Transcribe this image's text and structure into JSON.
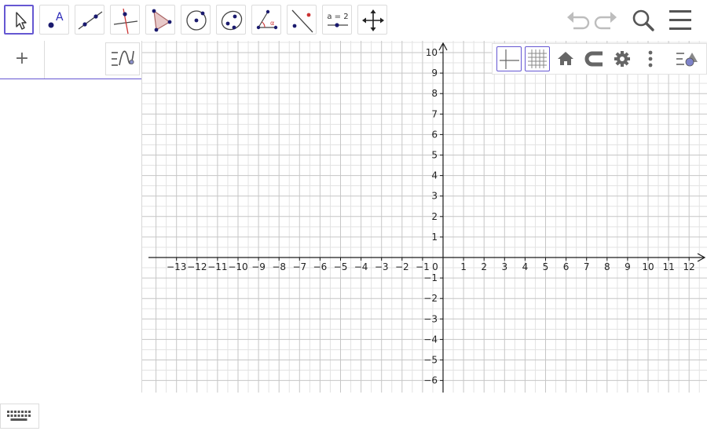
{
  "toolbar": {
    "tools": [
      {
        "name": "move-tool",
        "icon": "cursor-arrow-icon",
        "active": true
      },
      {
        "name": "point-tool",
        "icon": "point-label-icon",
        "label": "A"
      },
      {
        "name": "line-tool",
        "icon": "line-through-points-icon"
      },
      {
        "name": "perpendicular-line-tool",
        "icon": "perpendicular-line-icon"
      },
      {
        "name": "polygon-tool",
        "icon": "triangle-polygon-icon"
      },
      {
        "name": "circle-tool",
        "icon": "circle-center-icon"
      },
      {
        "name": "ellipse-tool",
        "icon": "ellipse-icon"
      },
      {
        "name": "angle-tool",
        "icon": "angle-icon",
        "label": "α"
      },
      {
        "name": "reflect-tool",
        "icon": "reflect-about-line-icon"
      },
      {
        "name": "slider-tool",
        "icon": "slider-icon",
        "label": "a = 2"
      },
      {
        "name": "move-graphics-view-tool",
        "icon": "move-arrows-icon"
      }
    ],
    "undo_icon": "undo-icon",
    "redo_icon": "redo-icon",
    "search_icon": "search-icon",
    "menu_icon": "hamburger-menu-icon"
  },
  "algebra": {
    "add_label": "+",
    "style_icon": "algebra-style-icon",
    "keyboard_icon": "keyboard-icon"
  },
  "graphics": {
    "x_range": [
      -14.3,
      12.7
    ],
    "y_range": [
      -6.4,
      10.6
    ],
    "x_ticks": [
      "−13",
      "−12",
      "−11",
      "−10",
      "−9",
      "−8",
      "−7",
      "−6",
      "−5",
      "−4",
      "−3",
      "−2",
      "−1",
      "0",
      "1",
      "2",
      "3",
      "4",
      "5",
      "6",
      "7",
      "8",
      "9",
      "10",
      "11",
      "12"
    ],
    "y_ticks": [
      "10",
      "9",
      "8",
      "7",
      "6",
      "5",
      "4",
      "3",
      "2",
      "1",
      "−1",
      "−2",
      "−3",
      "−4",
      "−5",
      "−6"
    ],
    "grid": true,
    "colors": {
      "grid_minor": "#e3e3e3",
      "grid_major": "#c6c6c6",
      "axis": "#1a1a1a",
      "accent": "#6557d2"
    }
  },
  "style_bar": {
    "buttons": [
      {
        "name": "axes-toggle-button",
        "icon": "axes-icon"
      },
      {
        "name": "grid-toggle-button",
        "icon": "grid-icon"
      },
      {
        "name": "home-button",
        "icon": "home-icon"
      },
      {
        "name": "point-capturing-button",
        "icon": "magnet-icon"
      },
      {
        "name": "graphics-settings-button",
        "icon": "gear-icon"
      },
      {
        "name": "more-options-button",
        "icon": "vertical-dots-icon"
      },
      {
        "name": "style-bar-toggle-button",
        "icon": "style-bar-toggle-icon"
      }
    ]
  }
}
